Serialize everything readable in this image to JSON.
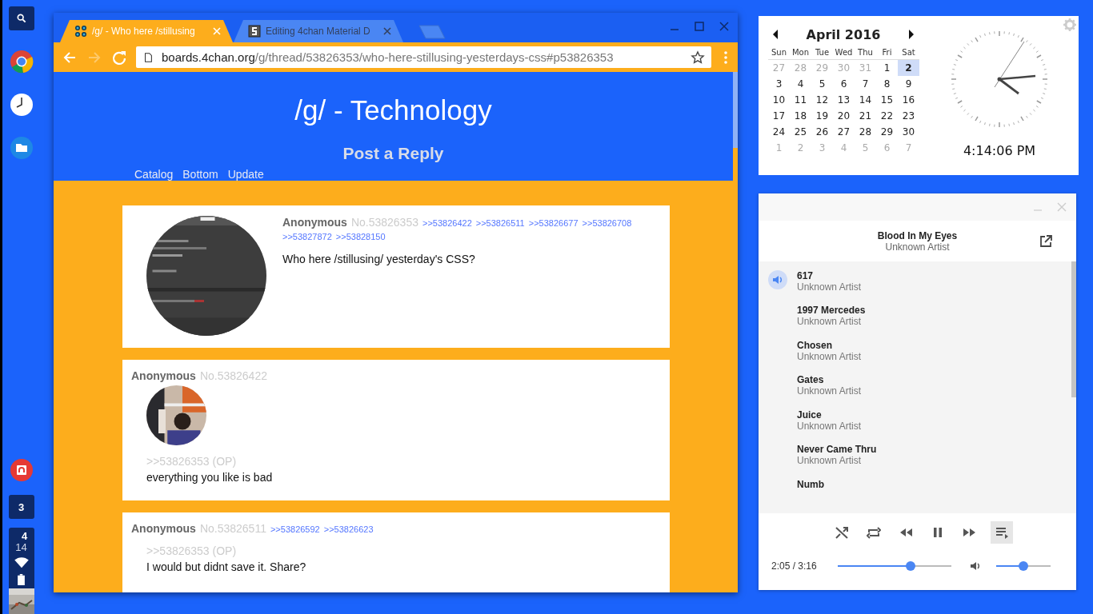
{
  "shelf": {
    "launcher": [
      {
        "kind": "search"
      },
      {
        "kind": "browser"
      },
      {
        "kind": "clock"
      },
      {
        "kind": "files"
      }
    ],
    "pinned": [
      {
        "kind": "app"
      }
    ],
    "badge": "3",
    "status": {
      "hour": "4",
      "minute": "14"
    },
    "avatar": {
      "kind": "picture"
    }
  },
  "browser": {
    "tabs": [
      {
        "title": "/g/ - Who here /stillusing",
        "selected": true
      },
      {
        "title": "Editing 4chan Material D",
        "selected": false
      }
    ],
    "nav": [
      {
        "kind": "back",
        "disabled": false
      },
      {
        "kind": "forward",
        "disabled": true
      },
      {
        "kind": "reload",
        "disabled": false
      }
    ],
    "url": {
      "host": "boards.4chan.org",
      "path": "/g/thread/53826353/who-here-stillusing-yesterdays-css#p53826353"
    },
    "page": {
      "title": "/g/ - Technology",
      "subtitle": "Post a Reply",
      "links": [
        "Catalog",
        "Bottom",
        "Update"
      ],
      "posts": [
        {
          "kind": "op",
          "name": "Anonymous",
          "number": "No.53826353",
          "backlinks": [
            ">>53826422",
            ">>53826511",
            ">>53826677",
            ">>53826708",
            ">>53827872",
            ">>53828150"
          ],
          "image": {
            "kind": "picture"
          },
          "body": "Who here /stillusing/ yesterday's CSS?"
        },
        {
          "kind": "reply",
          "name": "Anonymous",
          "number": "No.53826422",
          "image": {
            "kind": "picture"
          },
          "quote": ">>53826353 (OP)",
          "body": "everything you like is bad"
        },
        {
          "kind": "reply",
          "name": "Anonymous",
          "number": "No.53826511",
          "backlinks": [
            ">>53826592",
            ">>53826623"
          ],
          "quote": ">>53826353 (OP)",
          "body": "I would but didnt save it. Share?"
        }
      ]
    }
  },
  "calendar": {
    "month": "April 2016",
    "weekdays": [
      "Sun",
      "Mon",
      "Tue",
      "Wed",
      "Thu",
      "Fri",
      "Sat"
    ],
    "weeks": [
      [
        {
          "day": "27",
          "dimmed": true,
          "selected": false
        },
        {
          "day": "28",
          "dimmed": true,
          "selected": false
        },
        {
          "day": "29",
          "dimmed": true,
          "selected": false
        },
        {
          "day": "30",
          "dimmed": true,
          "selected": false
        },
        {
          "day": "31",
          "dimmed": true,
          "selected": false
        },
        {
          "day": "1",
          "dimmed": false,
          "selected": false
        },
        {
          "day": "2",
          "dimmed": false,
          "selected": true
        }
      ],
      [
        {
          "day": "3",
          "dimmed": false,
          "selected": false
        },
        {
          "day": "4",
          "dimmed": false,
          "selected": false
        },
        {
          "day": "5",
          "dimmed": false,
          "selected": false
        },
        {
          "day": "6",
          "dimmed": false,
          "selected": false
        },
        {
          "day": "7",
          "dimmed": false,
          "selected": false
        },
        {
          "day": "8",
          "dimmed": false,
          "selected": false
        },
        {
          "day": "9",
          "dimmed": false,
          "selected": false
        }
      ],
      [
        {
          "day": "10",
          "dimmed": false,
          "selected": false
        },
        {
          "day": "11",
          "dimmed": false,
          "selected": false
        },
        {
          "day": "12",
          "dimmed": false,
          "selected": false
        },
        {
          "day": "13",
          "dimmed": false,
          "selected": false
        },
        {
          "day": "14",
          "dimmed": false,
          "selected": false
        },
        {
          "day": "15",
          "dimmed": false,
          "selected": false
        },
        {
          "day": "16",
          "dimmed": false,
          "selected": false
        }
      ],
      [
        {
          "day": "17",
          "dimmed": false,
          "selected": false
        },
        {
          "day": "18",
          "dimmed": false,
          "selected": false
        },
        {
          "day": "19",
          "dimmed": false,
          "selected": false
        },
        {
          "day": "20",
          "dimmed": false,
          "selected": false
        },
        {
          "day": "21",
          "dimmed": false,
          "selected": false
        },
        {
          "day": "22",
          "dimmed": false,
          "selected": false
        },
        {
          "day": "23",
          "dimmed": false,
          "selected": false
        }
      ],
      [
        {
          "day": "24",
          "dimmed": false,
          "selected": false
        },
        {
          "day": "25",
          "dimmed": false,
          "selected": false
        },
        {
          "day": "26",
          "dimmed": false,
          "selected": false
        },
        {
          "day": "27",
          "dimmed": false,
          "selected": false
        },
        {
          "day": "28",
          "dimmed": false,
          "selected": false
        },
        {
          "day": "29",
          "dimmed": false,
          "selected": false
        },
        {
          "day": "30",
          "dimmed": false,
          "selected": false
        }
      ],
      [
        {
          "day": "1",
          "dimmed": true,
          "selected": false
        },
        {
          "day": "2",
          "dimmed": true,
          "selected": false
        },
        {
          "day": "3",
          "dimmed": true,
          "selected": false
        },
        {
          "day": "4",
          "dimmed": true,
          "selected": false
        },
        {
          "day": "5",
          "dimmed": true,
          "selected": false
        },
        {
          "day": "6",
          "dimmed": true,
          "selected": false
        },
        {
          "day": "7",
          "dimmed": true,
          "selected": false
        }
      ]
    ],
    "time": "4:14:06 PM"
  },
  "player": {
    "title": "Blood In My Eyes",
    "artist": "Unknown Artist",
    "tracks": [
      {
        "title": "617",
        "artist": "Unknown Artist",
        "selected": true
      },
      {
        "title": "1997 Mercedes",
        "artist": "Unknown Artist",
        "selected": false
      },
      {
        "title": "Chosen",
        "artist": "Unknown Artist",
        "selected": false
      },
      {
        "title": "Gates",
        "artist": "Unknown Artist",
        "selected": false
      },
      {
        "title": "Juice",
        "artist": "Unknown Artist",
        "selected": false
      },
      {
        "title": "Never Came Thru",
        "artist": "Unknown Artist",
        "selected": false
      },
      {
        "title": "Numb",
        "selected": false
      }
    ],
    "controls": [
      {
        "kind": "shuffle",
        "on": false
      },
      {
        "kind": "repeat",
        "on": false
      },
      {
        "kind": "previous",
        "on": false
      },
      {
        "kind": "pause",
        "on": false
      },
      {
        "kind": "next",
        "on": false
      },
      {
        "kind": "playlist",
        "on": true
      }
    ],
    "time": "2:05 / 3:16",
    "progress": {
      "level": 0.64
    },
    "volume": {
      "level": 0.5
    }
  }
}
